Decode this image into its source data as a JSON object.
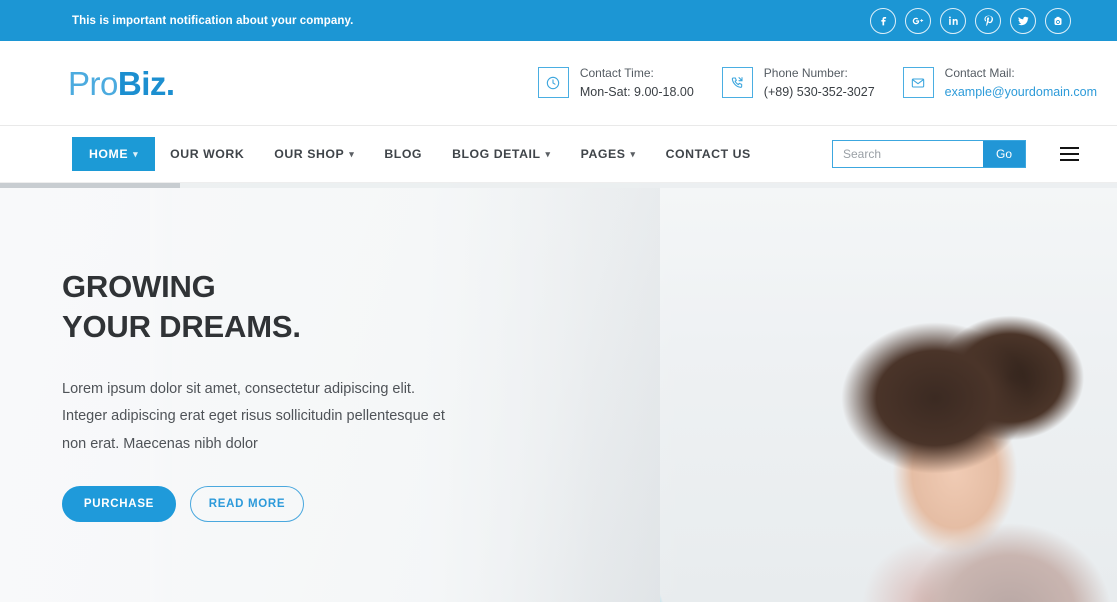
{
  "topbar": {
    "notification": "This is important notification about your company.",
    "bg_color": "#1c96d4",
    "socials": [
      {
        "name": "facebook",
        "glyph": "f"
      },
      {
        "name": "google-plus",
        "glyph": "G+"
      },
      {
        "name": "linkedin",
        "glyph": "in"
      },
      {
        "name": "pinterest",
        "glyph": "P"
      },
      {
        "name": "twitter",
        "glyph": "t"
      },
      {
        "name": "youtube",
        "glyph": "y"
      }
    ]
  },
  "header": {
    "logo": {
      "first": "Pro",
      "second": "Biz."
    },
    "contacts": [
      {
        "icon": "clock-icon",
        "label": "Contact Time:",
        "value": "Mon-Sat: 9.00-18.00",
        "is_link": false
      },
      {
        "icon": "phone-icon",
        "label": "Phone Number:",
        "value": "(+89) 530-352-3027",
        "is_link": false
      },
      {
        "icon": "mail-icon",
        "label": "Contact Mail:",
        "value": "example@yourdomain.com",
        "is_link": true
      }
    ]
  },
  "nav": {
    "items": [
      {
        "label": "HOME",
        "active": true,
        "dropdown": true
      },
      {
        "label": "OUR WORK",
        "active": false,
        "dropdown": false
      },
      {
        "label": "OUR SHOP",
        "active": false,
        "dropdown": true
      },
      {
        "label": "BLOG",
        "active": false,
        "dropdown": false
      },
      {
        "label": "BLOG DETAIL",
        "active": false,
        "dropdown": true
      },
      {
        "label": "PAGES",
        "active": false,
        "dropdown": true
      },
      {
        "label": "CONTACT US",
        "active": false,
        "dropdown": false
      }
    ],
    "search": {
      "placeholder": "Search",
      "value": "",
      "button_label": "Go"
    },
    "accent_color": "#1c9ad6"
  },
  "hero": {
    "title_line1": "GROWING",
    "title_line2": "YOUR DREAMS.",
    "description": "Lorem ipsum dolor sit amet, consectetur adipiscing elit. Integer adipiscing erat eget risus sollicitudin pellentesque et non erat. Maecenas nibh dolor",
    "primary_button": "PURCHASE",
    "secondary_button": "READ MORE",
    "progress_percent": 16
  }
}
